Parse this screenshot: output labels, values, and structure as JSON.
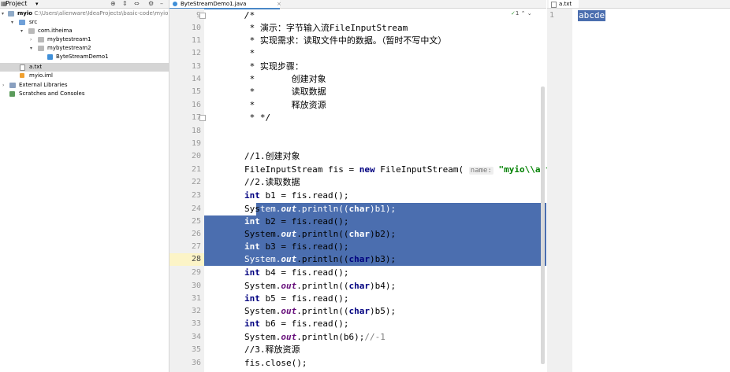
{
  "project_panel": {
    "title": "Project",
    "tree": [
      {
        "label": "myio",
        "path": "C:\\Users\\alienware\\IdeaProjects\\basic-code\\myio",
        "icon": "module-folder-icon",
        "arrow": "▾"
      },
      {
        "label": "src",
        "icon": "source-folder-icon",
        "arrow": "▾"
      },
      {
        "label": "com.itheima",
        "icon": "package-icon",
        "arrow": "▾"
      },
      {
        "label": "mybytestream1",
        "icon": "package-icon",
        "arrow": "›"
      },
      {
        "label": "mybytestream2",
        "icon": "package-icon",
        "arrow": "▾"
      },
      {
        "label": "ByteStreamDemo1",
        "icon": "java-class-icon"
      },
      {
        "label": "a.txt",
        "icon": "text-file-icon",
        "selected": true
      },
      {
        "label": "myio.iml",
        "icon": "iml-file-icon"
      },
      {
        "label": "External Libraries",
        "icon": "libraries-icon",
        "arrow": "›"
      },
      {
        "label": "Scratches and Consoles",
        "icon": "scratches-icon"
      }
    ]
  },
  "editor": {
    "tab_label": "ByteStreamDemo1.java",
    "inspection_count": "1",
    "line_numbers": [
      "9",
      "10",
      "11",
      "12",
      "13",
      "14",
      "15",
      "16",
      "17",
      "18",
      "19",
      "20",
      "21",
      "22",
      "23",
      "24",
      "25",
      "26",
      "27",
      "28",
      "29",
      "30",
      "31",
      "32",
      "33",
      "34",
      "35",
      "36"
    ],
    "code": {
      "l9": "/*",
      "l10": " * 演示：字节输入流FileInputStream",
      "l11": " * 实现需求：读取文件中的数据。（暂时不写中文）",
      "l12": " *",
      "l13": " * 实现步骤：",
      "l14": " *       创建对象",
      "l15": " *       读取数据",
      "l16": " *       释放资源",
      "l17": " * */",
      "l20": "//1.创建对象",
      "l21_a": "FileInputStream fis = ",
      "l21_kw": "new",
      "l21_b": " FileInputStream(",
      "l21_hint": "name:",
      "l21_str": "\"myio\\\\a.txt\"",
      "l22": "//2.读取数据",
      "int_kw": "int",
      "char_kw": "char",
      "sys": "System.",
      "out": "out",
      "l23": " b1 = fis.read();",
      "l24_pre": "Sys",
      "l24_a": "tem.",
      "println_open": ".println((",
      "l24_end": ")b1);",
      "l25": " b2 = fis.read();",
      "l26_end": ")b2);",
      "l27": " b3 = fis.read();",
      "l28_end": ")b3);",
      "l29": " b4 = fis.read();",
      "l30_end": ")b4);",
      "l31": " b5 = fis.read();",
      "l32_end": ")b5);",
      "l33": " b6 = fis.read();",
      "l34_a": ".println(b6);",
      "l34_cm": "//-1",
      "l35": "//3.释放资源",
      "l36": "fis.close();"
    }
  },
  "txt_panel": {
    "tab_label": "a.txt",
    "line_number": "1",
    "content": "abcde"
  }
}
